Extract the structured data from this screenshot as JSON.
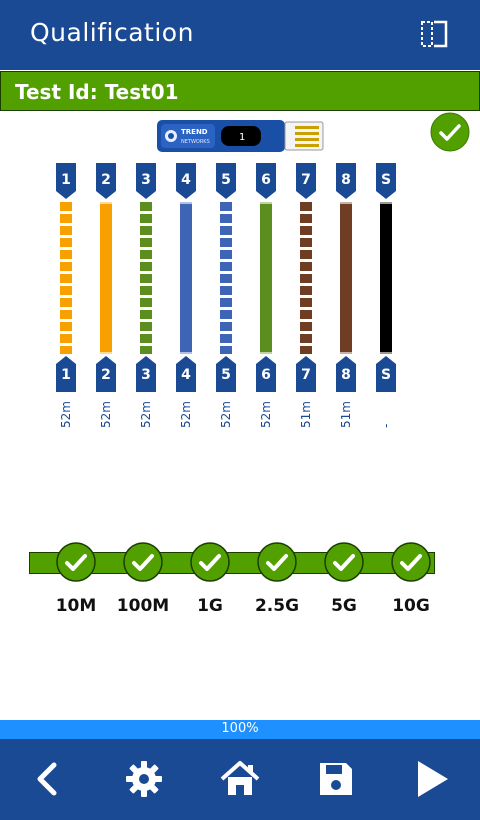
{
  "header": {
    "title": "Qualification",
    "panel_icon": "split-panel-icon"
  },
  "test": {
    "label": "Test Id: Test01"
  },
  "device": {
    "brand": "TREND",
    "model": "NETWORKS",
    "screen_text": "1",
    "icon": "tester-device-icon"
  },
  "result_icon": "check-circle-icon",
  "colors": {
    "header": "#1b4a94",
    "test_bar": "#52a000",
    "progress": "#1e90ff",
    "pin": "#1b4a94"
  },
  "wires": [
    {
      "pin": "1",
      "length": "52m",
      "color": "#f7a000",
      "pattern": "striped"
    },
    {
      "pin": "2",
      "length": "52m",
      "color": "#f7a000",
      "pattern": "solid"
    },
    {
      "pin": "3",
      "length": "52m",
      "color": "#5b8e1e",
      "pattern": "striped"
    },
    {
      "pin": "4",
      "length": "52m",
      "color": "#3e64b5",
      "pattern": "solid"
    },
    {
      "pin": "5",
      "length": "52m",
      "color": "#3e64b5",
      "pattern": "striped"
    },
    {
      "pin": "6",
      "length": "52m",
      "color": "#5b8e1e",
      "pattern": "solid"
    },
    {
      "pin": "7",
      "length": "51m",
      "color": "#6e3d24",
      "pattern": "striped"
    },
    {
      "pin": "8",
      "length": "51m",
      "color": "#6e3d24",
      "pattern": "solid"
    },
    {
      "pin": "S",
      "length": "-",
      "color": "#000000",
      "pattern": "solid"
    }
  ],
  "speeds": [
    {
      "label": "10M",
      "passed": true
    },
    {
      "label": "100M",
      "passed": true
    },
    {
      "label": "1G",
      "passed": true
    },
    {
      "label": "2.5G",
      "passed": true
    },
    {
      "label": "5G",
      "passed": true
    },
    {
      "label": "10G",
      "passed": true
    }
  ],
  "progress": {
    "value": 1.0,
    "text": "100%"
  },
  "footer": {
    "buttons": [
      "back-arrow-icon",
      "gear-icon",
      "home-icon",
      "save-icon",
      "play-icon"
    ]
  }
}
